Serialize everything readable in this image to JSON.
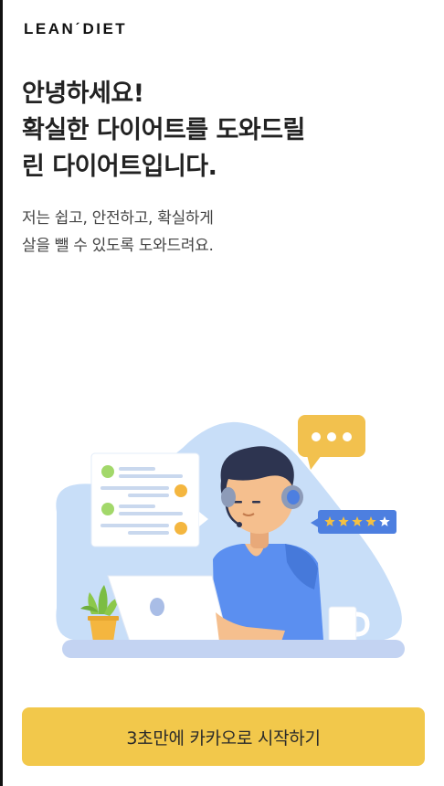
{
  "brand": {
    "logo_text": "LEANˊDIET"
  },
  "headline": {
    "line1": "안녕하세요!",
    "line2": "확실한 다이어트를 도와드릴",
    "line3": "린 다이어트입니다."
  },
  "subtext": {
    "line1": "저는 쉽고, 안전하고, 확실하게",
    "line2": "살을 뺄 수 있도록 도와드려요."
  },
  "illustration": {
    "icon": "customer-support-illustration",
    "rating_stars": 5,
    "colors": {
      "blob": "#c8def8",
      "desk": "#c3d3f2",
      "shirt": "#5b8ff0",
      "skin": "#f5bf8e",
      "hair": "#2d3450",
      "bubble": "#f2c14e",
      "rating_badge": "#4d7fe0",
      "dot_green": "#a2d86a",
      "dot_orange": "#f4b63f"
    }
  },
  "cta": {
    "label": "3초만에 카카오로 시작하기",
    "color": "#f2c84b"
  }
}
